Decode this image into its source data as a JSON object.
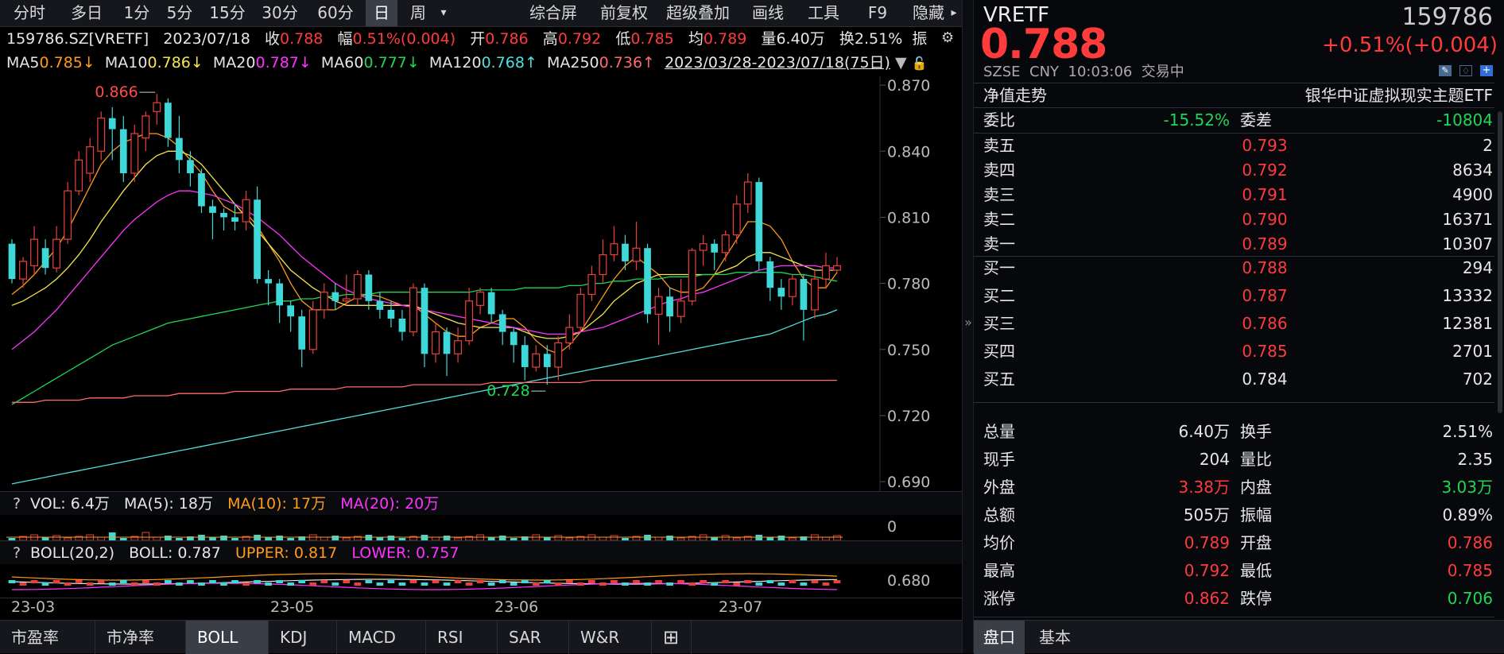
{
  "toolbar": {
    "periods": [
      "分时",
      "多日",
      "1分",
      "5分",
      "15分",
      "30分",
      "60分",
      "日",
      "周"
    ],
    "active": "日",
    "dropdown": "▾",
    "right": [
      "综合屏",
      "前复权",
      "超级叠加",
      "画线",
      "工具",
      "F9",
      "隐藏"
    ],
    "more": "▸"
  },
  "quote_line": {
    "code": "159786.SZ[VRETF]",
    "date": "2023/07/18",
    "close_label": "收",
    "close": "0.788",
    "change_label": "幅",
    "change": "0.51%(0.004)",
    "open_label": "开",
    "open": "0.786",
    "high_label": "高",
    "high": "0.792",
    "low_label": "低",
    "low": "0.785",
    "avg_label": "均",
    "avg": "0.789",
    "vol_label": "量",
    "vol": "6.40万",
    "turnover_label": "换",
    "turnover": "2.51%",
    "amp_label": "振"
  },
  "ma_line": {
    "items": [
      {
        "label": "MA5",
        "value": "0.785↓",
        "color": "#ff9a1a"
      },
      {
        "label": "MA10",
        "value": "0.786↓",
        "color": "#f5e64a"
      },
      {
        "label": "MA20",
        "value": "0.787↓",
        "color": "#ff33ff"
      },
      {
        "label": "MA60",
        "value": "0.777↓",
        "color": "#1fd655"
      },
      {
        "label": "MA120",
        "value": "0.768↑",
        "color": "#4fe0e0"
      },
      {
        "label": "MA250",
        "value": "0.736↑",
        "color": "#ff6a6a"
      }
    ],
    "range": "2023/03/28-2023/07/18(75日)"
  },
  "price_axis": [
    "0.870",
    "0.840",
    "0.810",
    "0.780",
    "0.750",
    "0.720",
    "0.690"
  ],
  "annotations": {
    "high": "0.866",
    "low": "0.728"
  },
  "vol_panel": {
    "q": "?",
    "name": "VOL: 6.4万",
    "ma5": "MA(5): 18万",
    "ma10": "MA(10): 17万",
    "ma20": "MA(20): 20万",
    "axis": "0"
  },
  "boll_panel": {
    "q": "?",
    "name": "BOLL(20,2)",
    "boll": "BOLL: 0.787",
    "upper": "UPPER: 0.817",
    "lower": "LOWER: 0.757",
    "axis": "0.680"
  },
  "time_axis": [
    "23-03",
    "23-05",
    "23-06",
    "23-07"
  ],
  "bottom_tabs": [
    "市盈率",
    "市净率",
    "BOLL",
    "KDJ",
    "MACD",
    "RSI",
    "SAR",
    "W&R",
    "⊞"
  ],
  "bottom_active": "BOLL",
  "right": {
    "name": "VRETF",
    "code": "159786",
    "price": "0.788",
    "change": "+0.51%(+0.004)",
    "exchange": "SZSE",
    "currency": "CNY",
    "time": "10:03:06",
    "status": "交易中",
    "nav_label": "净值走势",
    "fund_name": "银华中证虚拟现实主题ETF",
    "weibi_label": "委比",
    "weibi": "-15.52%",
    "weicha_label": "委差",
    "weicha": "-10804",
    "sell": [
      {
        "label": "卖五",
        "price": "0.793",
        "vol": "2"
      },
      {
        "label": "卖四",
        "price": "0.792",
        "vol": "8634"
      },
      {
        "label": "卖三",
        "price": "0.791",
        "vol": "4900"
      },
      {
        "label": "卖二",
        "price": "0.790",
        "vol": "16371"
      },
      {
        "label": "卖一",
        "price": "0.789",
        "vol": "10307"
      }
    ],
    "buy": [
      {
        "label": "买一",
        "price": "0.788",
        "vol": "294"
      },
      {
        "label": "买二",
        "price": "0.787",
        "vol": "13332"
      },
      {
        "label": "买三",
        "price": "0.786",
        "vol": "12381"
      },
      {
        "label": "买四",
        "price": "0.785",
        "vol": "2701"
      },
      {
        "label": "买五",
        "price": "0.784",
        "vol": "702"
      }
    ],
    "stats": [
      {
        "l1": "总量",
        "v1": "6.40万",
        "c1": "white",
        "l2": "换手",
        "v2": "2.51%",
        "c2": "white"
      },
      {
        "l1": "现手",
        "v1": "204",
        "c1": "white",
        "l2": "量比",
        "v2": "2.35",
        "c2": "white"
      },
      {
        "l1": "外盘",
        "v1": "3.38万",
        "c1": "red",
        "l2": "内盘",
        "v2": "3.03万",
        "c2": "green"
      },
      {
        "l1": "总额",
        "v1": "505万",
        "c1": "white",
        "l2": "振幅",
        "v2": "0.89%",
        "c2": "white"
      },
      {
        "l1": "均价",
        "v1": "0.789",
        "c1": "red",
        "l2": "开盘",
        "v2": "0.786",
        "c2": "red"
      },
      {
        "l1": "最高",
        "v1": "0.792",
        "c1": "red",
        "l2": "最低",
        "v2": "0.785",
        "c2": "red"
      },
      {
        "l1": "涨停",
        "v1": "0.862",
        "c1": "red",
        "l2": "跌停",
        "v2": "0.706",
        "c2": "green"
      }
    ],
    "tabs": [
      "盘口",
      "基本"
    ],
    "active_tab": "盘口"
  },
  "chart_data": {
    "type": "candlestick",
    "ylim": [
      0.685,
      0.874
    ],
    "up_color": "#e8413c",
    "down_color": "#3fd8d8",
    "candles": [
      [
        0.798,
        0.782,
        0.8,
        0.78
      ],
      [
        0.782,
        0.79,
        0.792,
        0.778
      ],
      [
        0.788,
        0.8,
        0.806,
        0.784
      ],
      [
        0.796,
        0.787,
        0.8,
        0.784
      ],
      [
        0.787,
        0.8,
        0.806,
        0.785
      ],
      [
        0.8,
        0.822,
        0.826,
        0.798
      ],
      [
        0.822,
        0.836,
        0.84,
        0.82
      ],
      [
        0.83,
        0.842,
        0.846,
        0.826
      ],
      [
        0.84,
        0.855,
        0.858,
        0.836
      ],
      [
        0.855,
        0.85,
        0.86,
        0.836
      ],
      [
        0.85,
        0.83,
        0.856,
        0.826
      ],
      [
        0.83,
        0.848,
        0.852,
        0.826
      ],
      [
        0.846,
        0.856,
        0.858,
        0.84
      ],
      [
        0.858,
        0.862,
        0.866,
        0.852
      ],
      [
        0.862,
        0.846,
        0.864,
        0.842
      ],
      [
        0.846,
        0.836,
        0.856,
        0.83
      ],
      [
        0.836,
        0.83,
        0.84,
        0.824
      ],
      [
        0.83,
        0.815,
        0.832,
        0.812
      ],
      [
        0.815,
        0.812,
        0.818,
        0.8
      ],
      [
        0.812,
        0.81,
        0.814,
        0.804
      ],
      [
        0.81,
        0.808,
        0.816,
        0.804
      ],
      [
        0.808,
        0.818,
        0.822,
        0.804
      ],
      [
        0.818,
        0.782,
        0.824,
        0.78
      ],
      [
        0.782,
        0.78,
        0.786,
        0.77
      ],
      [
        0.78,
        0.77,
        0.782,
        0.762
      ],
      [
        0.77,
        0.765,
        0.772,
        0.758
      ],
      [
        0.765,
        0.75,
        0.768,
        0.742
      ],
      [
        0.75,
        0.768,
        0.772,
        0.748
      ],
      [
        0.768,
        0.776,
        0.78,
        0.764
      ],
      [
        0.776,
        0.772,
        0.78,
        0.768
      ],
      [
        0.772,
        0.773,
        0.784,
        0.77
      ],
      [
        0.773,
        0.784,
        0.786,
        0.77
      ],
      [
        0.784,
        0.772,
        0.786,
        0.768
      ],
      [
        0.772,
        0.768,
        0.776,
        0.764
      ],
      [
        0.768,
        0.764,
        0.772,
        0.76
      ],
      [
        0.764,
        0.758,
        0.768,
        0.754
      ],
      [
        0.758,
        0.778,
        0.78,
        0.756
      ],
      [
        0.778,
        0.748,
        0.78,
        0.742
      ],
      [
        0.748,
        0.758,
        0.762,
        0.744
      ],
      [
        0.758,
        0.748,
        0.76,
        0.738
      ],
      [
        0.748,
        0.754,
        0.76,
        0.744
      ],
      [
        0.754,
        0.772,
        0.778,
        0.752
      ],
      [
        0.77,
        0.776,
        0.778,
        0.766
      ],
      [
        0.776,
        0.766,
        0.778,
        0.762
      ],
      [
        0.766,
        0.758,
        0.768,
        0.752
      ],
      [
        0.758,
        0.752,
        0.76,
        0.744
      ],
      [
        0.752,
        0.742,
        0.756,
        0.736
      ],
      [
        0.742,
        0.748,
        0.752,
        0.74
      ],
      [
        0.748,
        0.742,
        0.752,
        0.734
      ],
      [
        0.742,
        0.753,
        0.756,
        0.736
      ],
      [
        0.753,
        0.76,
        0.766,
        0.75
      ],
      [
        0.76,
        0.775,
        0.778,
        0.758
      ],
      [
        0.775,
        0.784,
        0.788,
        0.772
      ],
      [
        0.784,
        0.793,
        0.8,
        0.78
      ],
      [
        0.793,
        0.798,
        0.806,
        0.79
      ],
      [
        0.798,
        0.79,
        0.802,
        0.786
      ],
      [
        0.79,
        0.796,
        0.808,
        0.786
      ],
      [
        0.796,
        0.766,
        0.798,
        0.762
      ],
      [
        0.766,
        0.774,
        0.778,
        0.752
      ],
      [
        0.774,
        0.765,
        0.778,
        0.758
      ],
      [
        0.765,
        0.772,
        0.782,
        0.762
      ],
      [
        0.772,
        0.795,
        0.796,
        0.77
      ],
      [
        0.795,
        0.798,
        0.802,
        0.788
      ],
      [
        0.798,
        0.794,
        0.8,
        0.786
      ],
      [
        0.794,
        0.802,
        0.804,
        0.79
      ],
      [
        0.802,
        0.816,
        0.82,
        0.798
      ],
      [
        0.816,
        0.826,
        0.83,
        0.812
      ],
      [
        0.826,
        0.79,
        0.828,
        0.786
      ],
      [
        0.79,
        0.778,
        0.792,
        0.772
      ],
      [
        0.778,
        0.774,
        0.782,
        0.768
      ],
      [
        0.774,
        0.782,
        0.784,
        0.77
      ],
      [
        0.782,
        0.768,
        0.784,
        0.754
      ],
      [
        0.768,
        0.782,
        0.786,
        0.764
      ],
      [
        0.782,
        0.788,
        0.794,
        0.778
      ],
      [
        0.786,
        0.788,
        0.792,
        0.785
      ]
    ],
    "ma_series": [
      {
        "name": "MA5",
        "color": "#ff9a1a",
        "values": [
          0.775,
          0.779,
          0.784,
          0.79,
          0.796,
          0.804,
          0.814,
          0.824,
          0.834,
          0.84,
          0.844,
          0.846,
          0.848,
          0.848,
          0.846,
          0.842,
          0.836,
          0.83,
          0.822,
          0.815,
          0.812,
          0.812,
          0.806,
          0.798,
          0.79,
          0.78,
          0.772,
          0.768,
          0.768,
          0.768,
          0.771,
          0.774,
          0.775,
          0.774,
          0.772,
          0.77,
          0.77,
          0.766,
          0.762,
          0.758,
          0.756,
          0.756,
          0.76,
          0.762,
          0.764,
          0.764,
          0.76,
          0.754,
          0.75,
          0.748,
          0.752,
          0.758,
          0.766,
          0.774,
          0.782,
          0.788,
          0.792,
          0.788,
          0.784,
          0.778,
          0.776,
          0.776,
          0.778,
          0.784,
          0.792,
          0.8,
          0.808,
          0.808,
          0.806,
          0.8,
          0.79,
          0.782,
          0.778,
          0.778,
          0.785
        ]
      },
      {
        "name": "MA10",
        "color": "#f5e64a",
        "values": [
          0.77,
          0.772,
          0.775,
          0.778,
          0.782,
          0.787,
          0.793,
          0.8,
          0.808,
          0.815,
          0.822,
          0.828,
          0.834,
          0.838,
          0.84,
          0.84,
          0.838,
          0.834,
          0.828,
          0.822,
          0.816,
          0.81,
          0.804,
          0.798,
          0.792,
          0.786,
          0.782,
          0.778,
          0.775,
          0.772,
          0.77,
          0.77,
          0.77,
          0.77,
          0.77,
          0.77,
          0.77,
          0.768,
          0.766,
          0.764,
          0.762,
          0.761,
          0.76,
          0.76,
          0.76,
          0.76,
          0.758,
          0.756,
          0.755,
          0.755,
          0.756,
          0.758,
          0.762,
          0.766,
          0.772,
          0.776,
          0.78,
          0.782,
          0.784,
          0.784,
          0.784,
          0.784,
          0.784,
          0.784,
          0.786,
          0.788,
          0.792,
          0.794,
          0.794,
          0.792,
          0.79,
          0.788,
          0.786,
          0.786,
          0.786
        ]
      },
      {
        "name": "MA20",
        "color": "#ff33ff",
        "values": [
          0.75,
          0.754,
          0.758,
          0.763,
          0.768,
          0.774,
          0.78,
          0.786,
          0.792,
          0.798,
          0.804,
          0.809,
          0.813,
          0.817,
          0.82,
          0.822,
          0.822,
          0.821,
          0.82,
          0.818,
          0.816,
          0.813,
          0.81,
          0.806,
          0.802,
          0.797,
          0.792,
          0.788,
          0.784,
          0.78,
          0.777,
          0.775,
          0.773,
          0.772,
          0.771,
          0.77,
          0.769,
          0.768,
          0.767,
          0.766,
          0.765,
          0.764,
          0.763,
          0.762,
          0.761,
          0.76,
          0.759,
          0.758,
          0.757,
          0.757,
          0.757,
          0.758,
          0.759,
          0.76,
          0.762,
          0.764,
          0.766,
          0.768,
          0.77,
          0.772,
          0.773,
          0.775,
          0.776,
          0.778,
          0.78,
          0.782,
          0.784,
          0.786,
          0.787,
          0.788,
          0.788,
          0.788,
          0.788,
          0.787,
          0.787
        ]
      },
      {
        "name": "MA60",
        "color": "#1fd655",
        "values": [
          0.725,
          0.728,
          0.731,
          0.734,
          0.737,
          0.74,
          0.743,
          0.746,
          0.749,
          0.752,
          0.754,
          0.756,
          0.758,
          0.76,
          0.762,
          0.763,
          0.764,
          0.765,
          0.766,
          0.767,
          0.768,
          0.769,
          0.77,
          0.771,
          0.772,
          0.772,
          0.773,
          0.773,
          0.774,
          0.774,
          0.775,
          0.775,
          0.775,
          0.776,
          0.776,
          0.776,
          0.776,
          0.776,
          0.776,
          0.776,
          0.776,
          0.776,
          0.777,
          0.777,
          0.777,
          0.777,
          0.778,
          0.778,
          0.778,
          0.778,
          0.779,
          0.779,
          0.78,
          0.78,
          0.781,
          0.781,
          0.782,
          0.782,
          0.782,
          0.783,
          0.783,
          0.783,
          0.784,
          0.784,
          0.784,
          0.785,
          0.785,
          0.785,
          0.785,
          0.785,
          0.784,
          0.784,
          0.783,
          0.782,
          0.781
        ]
      },
      {
        "name": "MA120",
        "color": "#4fe0e0",
        "values": [
          0.689,
          0.69,
          0.691,
          0.692,
          0.693,
          0.694,
          0.695,
          0.696,
          0.697,
          0.698,
          0.699,
          0.7,
          0.701,
          0.702,
          0.703,
          0.704,
          0.705,
          0.706,
          0.707,
          0.708,
          0.709,
          0.71,
          0.711,
          0.712,
          0.713,
          0.714,
          0.715,
          0.716,
          0.717,
          0.718,
          0.719,
          0.72,
          0.721,
          0.722,
          0.723,
          0.724,
          0.725,
          0.726,
          0.727,
          0.728,
          0.729,
          0.73,
          0.731,
          0.732,
          0.733,
          0.734,
          0.735,
          0.736,
          0.737,
          0.738,
          0.739,
          0.74,
          0.741,
          0.742,
          0.743,
          0.744,
          0.745,
          0.746,
          0.747,
          0.748,
          0.749,
          0.75,
          0.751,
          0.752,
          0.753,
          0.754,
          0.755,
          0.756,
          0.757,
          0.759,
          0.761,
          0.763,
          0.765,
          0.766,
          0.768
        ]
      },
      {
        "name": "MA250",
        "color": "#ff6a6a",
        "values": [
          0.726,
          0.726,
          0.726,
          0.727,
          0.727,
          0.727,
          0.727,
          0.728,
          0.728,
          0.728,
          0.728,
          0.729,
          0.729,
          0.729,
          0.729,
          0.73,
          0.73,
          0.73,
          0.73,
          0.73,
          0.731,
          0.731,
          0.731,
          0.731,
          0.731,
          0.732,
          0.732,
          0.732,
          0.732,
          0.732,
          0.733,
          0.733,
          0.733,
          0.733,
          0.733,
          0.733,
          0.734,
          0.734,
          0.734,
          0.734,
          0.734,
          0.734,
          0.734,
          0.735,
          0.735,
          0.735,
          0.735,
          0.735,
          0.735,
          0.735,
          0.735,
          0.735,
          0.736,
          0.736,
          0.736,
          0.736,
          0.736,
          0.736,
          0.736,
          0.736,
          0.736,
          0.736,
          0.736,
          0.736,
          0.736,
          0.736,
          0.736,
          0.736,
          0.736,
          0.736,
          0.736,
          0.736,
          0.736,
          0.736,
          0.736
        ]
      }
    ]
  }
}
